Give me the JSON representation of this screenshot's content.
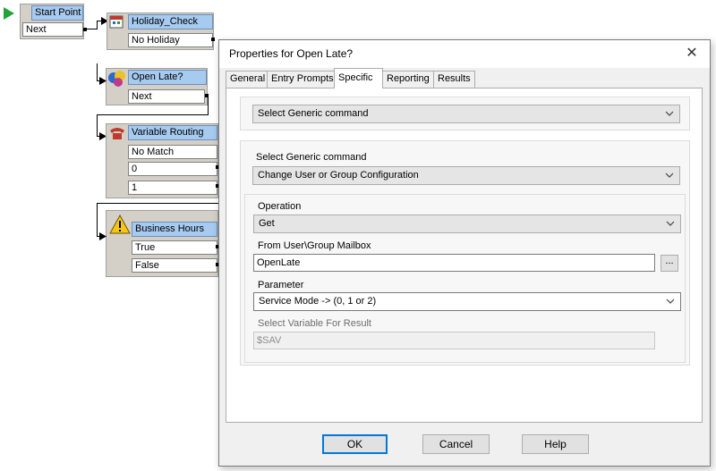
{
  "flow": {
    "start_point": {
      "title": "Start Point",
      "exits": [
        "Next"
      ]
    },
    "holiday_check": {
      "title": "Holiday_Check",
      "exits": [
        "No Holiday"
      ]
    },
    "open_late": {
      "title": "Open Late?",
      "exits": [
        "Next"
      ]
    },
    "variable_routing": {
      "title": "Variable Routing",
      "exits": [
        "No Match",
        "0",
        "1"
      ]
    },
    "business_hours": {
      "title": "Business Hours",
      "exits": [
        "True",
        "False"
      ]
    }
  },
  "dialog": {
    "title": "Properties for Open Late?",
    "close_glyph": "✕",
    "tabs": [
      "General",
      "Entry Prompts",
      "Specific",
      "Reporting",
      "Results"
    ],
    "active_tab": "Specific",
    "top_select_value": "Select Generic command",
    "generic_command_label": "Select Generic command",
    "generic_command_value": "Change User or Group Configuration",
    "operation_label": "Operation",
    "operation_value": "Get",
    "mailbox_label": "From User\\Group Mailbox",
    "mailbox_value": "OpenLate",
    "browse_label": "...",
    "parameter_label": "Parameter",
    "parameter_value": "Service Mode -> (0, 1 or 2)",
    "result_var_label": "Select Variable For Result",
    "result_var_value": "$SAV",
    "buttons": {
      "ok": "OK",
      "cancel": "Cancel",
      "help": "Help"
    }
  },
  "colors": {
    "node_header": "#a6caf0",
    "accent_focus": "#0078d7",
    "start_arrow": "#22a33a"
  }
}
